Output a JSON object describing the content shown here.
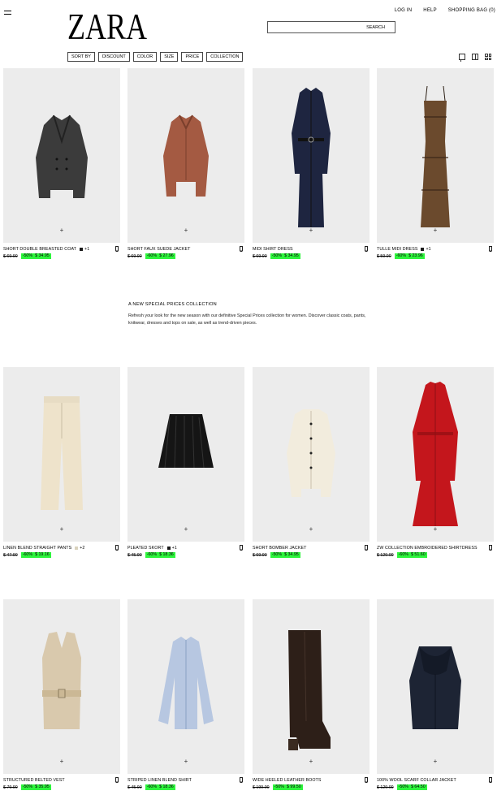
{
  "header": {
    "brand": "ZARA",
    "login": "LOG IN",
    "help": "HELP",
    "bag": "SHOPPING BAG (0)",
    "search_label": "SEARCH"
  },
  "filters": [
    "SORT BY",
    "DISCOUNT",
    "COLOR",
    "SIZE",
    "PRICE",
    "COLLECTION"
  ],
  "view_icons": [
    "single-view-icon",
    "two-column-view-icon",
    "grid-view-icon"
  ],
  "promo": {
    "title": "A NEW SPECIAL PRICES COLLECTION",
    "text": "Refresh your look for the new season with our definitive Special Prices collection for women. Discover classic coats, pants, knitwear, dresses and tops on sale, as well as trend-driven pieces."
  },
  "colors": {
    "sale_highlight": "#2ef53d",
    "photo_bg": "#ececec"
  },
  "products": [
    {
      "name": "SHORT DOUBLE BREASTED COAT",
      "swatch": "#1a1a1a",
      "more": "+1",
      "old_price": "$ 69.90",
      "discount": "-50%",
      "price": "$ 34.95",
      "image": "coat-jacket-icon"
    },
    {
      "name": "SHORT FAUX SUEDE JACKET",
      "swatch": "",
      "more": "",
      "old_price": "$ 69.90",
      "discount": "-60%",
      "price": "$ 27.96",
      "image": "suede-jacket-icon"
    },
    {
      "name": "MIDI SHIRT DRESS",
      "swatch": "",
      "more": "",
      "old_price": "$ 69.90",
      "discount": "-50%",
      "price": "$ 34.95",
      "image": "shirt-dress-icon"
    },
    {
      "name": "TULLE MIDI DRESS",
      "swatch": "#1a1a1a",
      "more": "+1",
      "old_price": "$ 59.90",
      "discount": "-60%",
      "price": "$ 23.96",
      "image": "slip-dress-icon"
    },
    {
      "name": "LINEN BLEND STRAIGHT PANTS",
      "swatch": "#d9d2bd",
      "more": "+2",
      "old_price": "$ 47.90",
      "discount": "-60%",
      "price": "$ 19.16",
      "image": "pants-icon"
    },
    {
      "name": "PLEATED SKORT",
      "swatch": "#1a1a1a",
      "more": "+1",
      "old_price": "$ 45.90",
      "discount": "-60%",
      "price": "$ 18.36",
      "image": "skort-icon"
    },
    {
      "name": "SHORT BOMBER JACKET",
      "swatch": "",
      "more": "",
      "old_price": "$ 69.90",
      "discount": "-50%",
      "price": "$ 34.95",
      "image": "bomber-jacket-icon"
    },
    {
      "name": "ZW COLLECTION EMBROIDERED SHIRTDRESS",
      "swatch": "",
      "more": "",
      "old_price": "$ 129.00",
      "discount": "-60%",
      "price": "$ 51.60",
      "image": "red-shirtdress-icon"
    },
    {
      "name": "STRUCTURED BELTED VEST",
      "swatch": "",
      "more": "",
      "old_price": "$ 79.90",
      "discount": "-50%",
      "price": "$ 35.95",
      "image": "vest-icon"
    },
    {
      "name": "STRIPED LINEN BLEND SHIRT",
      "swatch": "",
      "more": "",
      "old_price": "$ 45.90",
      "discount": "-60%",
      "price": "$ 18.36",
      "image": "shirt-icon"
    },
    {
      "name": "WIDE HEELED LEATHER BOOTS",
      "swatch": "",
      "more": "",
      "old_price": "$ 199.00",
      "discount": "-50%",
      "price": "$ 99.50",
      "image": "boots-icon"
    },
    {
      "name": "100% WOOL SCARF COLLAR JACKET",
      "swatch": "",
      "more": "",
      "old_price": "$ 129.00",
      "discount": "-50%",
      "price": "$ 64.50",
      "image": "wool-jacket-icon"
    }
  ]
}
